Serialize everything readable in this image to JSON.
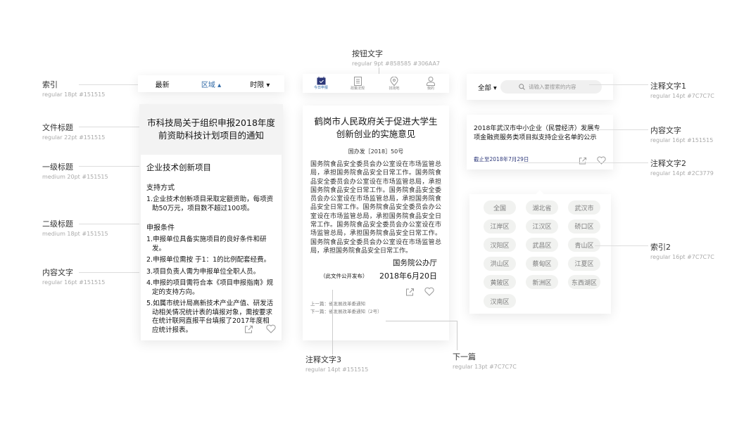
{
  "annotations": {
    "index": {
      "title": "索引",
      "spec": "regular 18pt #151515"
    },
    "doc_title": {
      "title": "文件标题",
      "spec": "regular 22pt #151515"
    },
    "h1": {
      "title": "一级标题",
      "spec": "medium 20pt #151515"
    },
    "h2": {
      "title": "二级标题",
      "spec": "medium 18pt #151515"
    },
    "body": {
      "title": "内容文字",
      "spec": "regular 16pt #151515"
    },
    "button_text": {
      "title": "按钮文字",
      "spec": "regular 9pt #858585 #306AA7"
    },
    "note3": {
      "title": "注释文字3",
      "spec": "regular 14pt #151515"
    },
    "next": {
      "title": "下一篇",
      "spec": "regular 13pt #7C7C7C"
    },
    "note1": {
      "title": "注释文字1",
      "spec": "regular 14pt #7C7C7C"
    },
    "content": {
      "title": "内容文字",
      "spec": "regular 16pt #151515"
    },
    "note2": {
      "title": "注释文字2",
      "spec": "regular 14pt #2C3779"
    },
    "index2": {
      "title": "索引2",
      "spec": "regular 16pt #7C7C7C"
    }
  },
  "filter_bar": {
    "items": [
      {
        "label": "最新"
      },
      {
        "label": "区域 ▴"
      },
      {
        "label": "时限 ▾"
      }
    ],
    "active_color": "#306AA7"
  },
  "doc1": {
    "title": "市科技局关于组织申报2018年度前资助科技计划项目的通知",
    "h1": "企业技术创新项目",
    "sections": [
      {
        "heading": "支持方式",
        "items": [
          "1.企业技术创新项目采取定额资助，每项资助50万元，项目数不超过100项。"
        ]
      },
      {
        "heading": "申报条件",
        "items": [
          "1.申报单位具备实施项目的良好条件和研发。",
          "2.申报单位需按 于1：1的比例配套经费。",
          "3.项目负责人需为申报单位全职人员。",
          "4.申报的项目需符合本《项目申报指南》规定的支持方向。",
          "5.如属市统计局高新技术产业产值、研发活动相关情况统计表的填报对象，需按要求在统计联网直报平台填报了2017年度相应统计报表。"
        ]
      }
    ]
  },
  "tabbar": {
    "items": [
      {
        "label": "今日申报",
        "icon": "calendar-check-icon",
        "active": true
      },
      {
        "label": "政策法规",
        "icon": "document-icon"
      },
      {
        "label": "找场地",
        "icon": "location-pin-icon"
      },
      {
        "label": "我的",
        "icon": "user-icon"
      }
    ],
    "active_color": "#306AA7",
    "inactive_color": "#858585"
  },
  "doc2": {
    "title": "鹤岗市人民政府关于促进大学生创新创业的实施意见",
    "number": "国办发［2018］50号",
    "body": "国务院食品安全委员会办公室设在市场监管总局，承担国务院食品安全日常工作。国务院食品安全委员会办公室设在市场监管总局，承担国务院食品安全日常工作。国务院食品安全委员会办公室设在市场监管总局，承担国务院食品安全日常工作。国务院食品安全委员会办公室设在市场监管总局，承担国务院食品安全日常工作。国务院食品安全委员会办公室设在市场监管总局，承担国务院食品安全日常工作。国务院食品安全委员会办公室设在市场监管总局，承担国务院食品安全日常工作。",
    "issuer": "国务院公办厅",
    "public_note": "（此文件公开发布）",
    "date": "2018年6月20日",
    "prev": "上一篇：省发展改革委通知",
    "next": "下一篇：省发展改革委通知（2号）"
  },
  "search": {
    "scope": "全部 ▾",
    "placeholder": "请输入要搜索的内容"
  },
  "list_item": {
    "title": "2018年武汉市中小企业（民营经济）发展专项金融资服务类项目拟支持企业名单的公示",
    "deadline": "截止至2018年7月29日",
    "deadline_color": "#2C3779"
  },
  "regions": [
    "全国",
    "湖北省",
    "武汉市",
    "江岸区",
    "江汉区",
    "硚口区",
    "汉阳区",
    "武昌区",
    "青山区",
    "洪山区",
    "蔡甸区",
    "江夏区",
    "黄陂区",
    "新洲区",
    "东西湖区",
    "汉南区"
  ]
}
